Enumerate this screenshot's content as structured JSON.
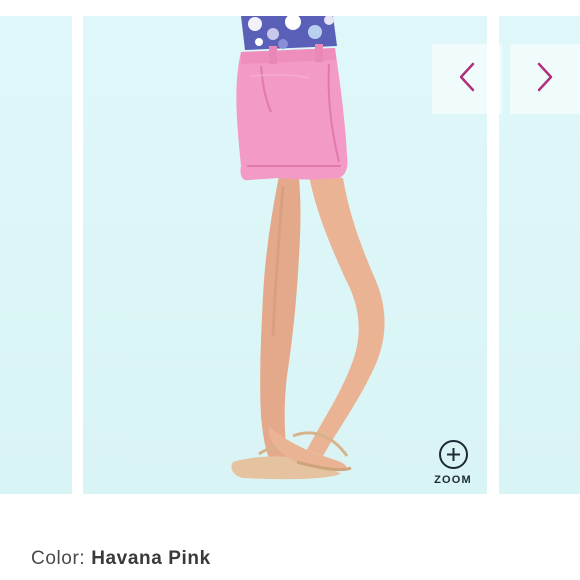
{
  "zoom": {
    "label": "ZOOM",
    "icon": "plus-circle-icon"
  },
  "navigation": {
    "prev_icon": "chevron-left-icon",
    "next_icon": "chevron-right-icon",
    "arrow_color": "#b0307a"
  },
  "product": {
    "color_label": "Color:",
    "color_value": "Havana Pink",
    "shorts_color": "#f49ac6",
    "backdrop_color": "#dcf6f7"
  }
}
